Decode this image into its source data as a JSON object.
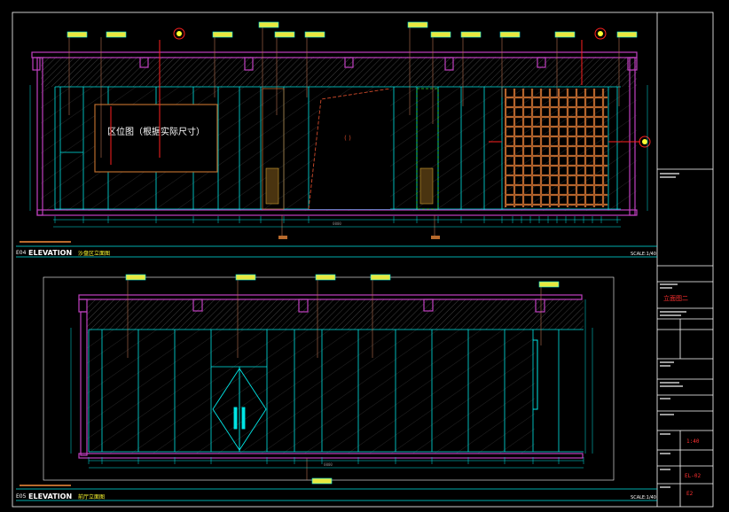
{
  "colors": {
    "background": "#000000",
    "frame": "#ffffff",
    "cyan": "#00e5e5",
    "magenta": "#c040c0",
    "red": "#ff2020",
    "yellow": "#ffff33",
    "brown": "#b86a2c",
    "green": "#33dd33",
    "orange": "#d07830",
    "tag_fill": "#e8e840"
  },
  "upper_elevation": {
    "code": "E04",
    "title_en": "ELEVATION",
    "title_cn": "沙盘区立面图",
    "scale": "SCALE:1/40",
    "panel_text": "区位图（根据实际尺寸）",
    "door_text": "(  )",
    "bottom_total": "0000"
  },
  "lower_elevation": {
    "code": "E05",
    "title_en": "ELEVATION",
    "title_cn": "前厅立面图",
    "scale": "SCALE:1/40",
    "bottom_total": "0000"
  },
  "title_block": {
    "drawing_name": "立面图二",
    "scale_value": "1:40",
    "sheet_code": "EL-02",
    "page": "E2"
  }
}
